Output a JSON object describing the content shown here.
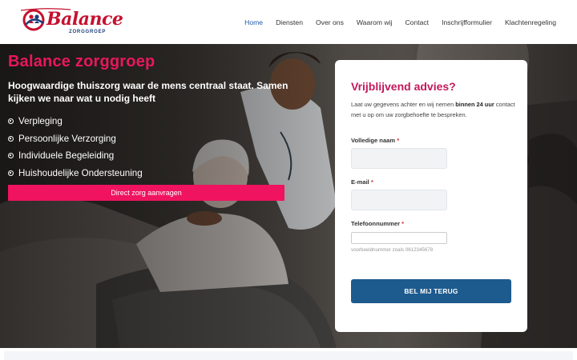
{
  "brand": {
    "name": "Balance",
    "tagline": "ZORGGROEP",
    "colors": {
      "red": "#c4122f",
      "navy": "#1e3d7a"
    }
  },
  "nav": {
    "items": [
      {
        "label": "Home",
        "active": true
      },
      {
        "label": "Diensten",
        "active": false
      },
      {
        "label": "Over ons",
        "active": false
      },
      {
        "label": "Waarom wij",
        "active": false
      },
      {
        "label": "Contact",
        "active": false
      },
      {
        "label": "Inschrijfformulier",
        "active": false
      },
      {
        "label": "Klachtenregeling",
        "active": false
      }
    ],
    "active_color": "#1e5aa8"
  },
  "hero": {
    "title": "Balance zorggroep",
    "subtitle": "Hoogwaardige thuiszorg waar de mens centraal staat. Samen kijken we naar wat u nodig heeft",
    "services": [
      "Verpleging",
      "Persoonlijke Verzorging",
      "Individuele Begeleiding",
      "Huishoudelijke Ondersteuning"
    ],
    "cta_label": "Direct zorg aanvragen",
    "accent_color": "#f0135f"
  },
  "form": {
    "title": "Vrijblijvend advies?",
    "desc_before": "Laat uw gegevens achter en wij nemen ",
    "desc_bold": "binnen 24 uur",
    "desc_after": " contact met u op om uw zorgbehoefte te bespreken.",
    "fields": {
      "name": {
        "label": "Volledige naam",
        "required_mark": "*",
        "value": ""
      },
      "email": {
        "label": "E-mail",
        "required_mark": "*",
        "value": ""
      },
      "phone": {
        "label": "Telefoonnummer",
        "required_mark": "*",
        "value": "",
        "hint": "voorbeeldnummer zoals 0612345678"
      }
    },
    "submit_label": "BEL MIJ TERUG",
    "submit_color": "#1d5a8e",
    "title_color": "#c2185b"
  }
}
